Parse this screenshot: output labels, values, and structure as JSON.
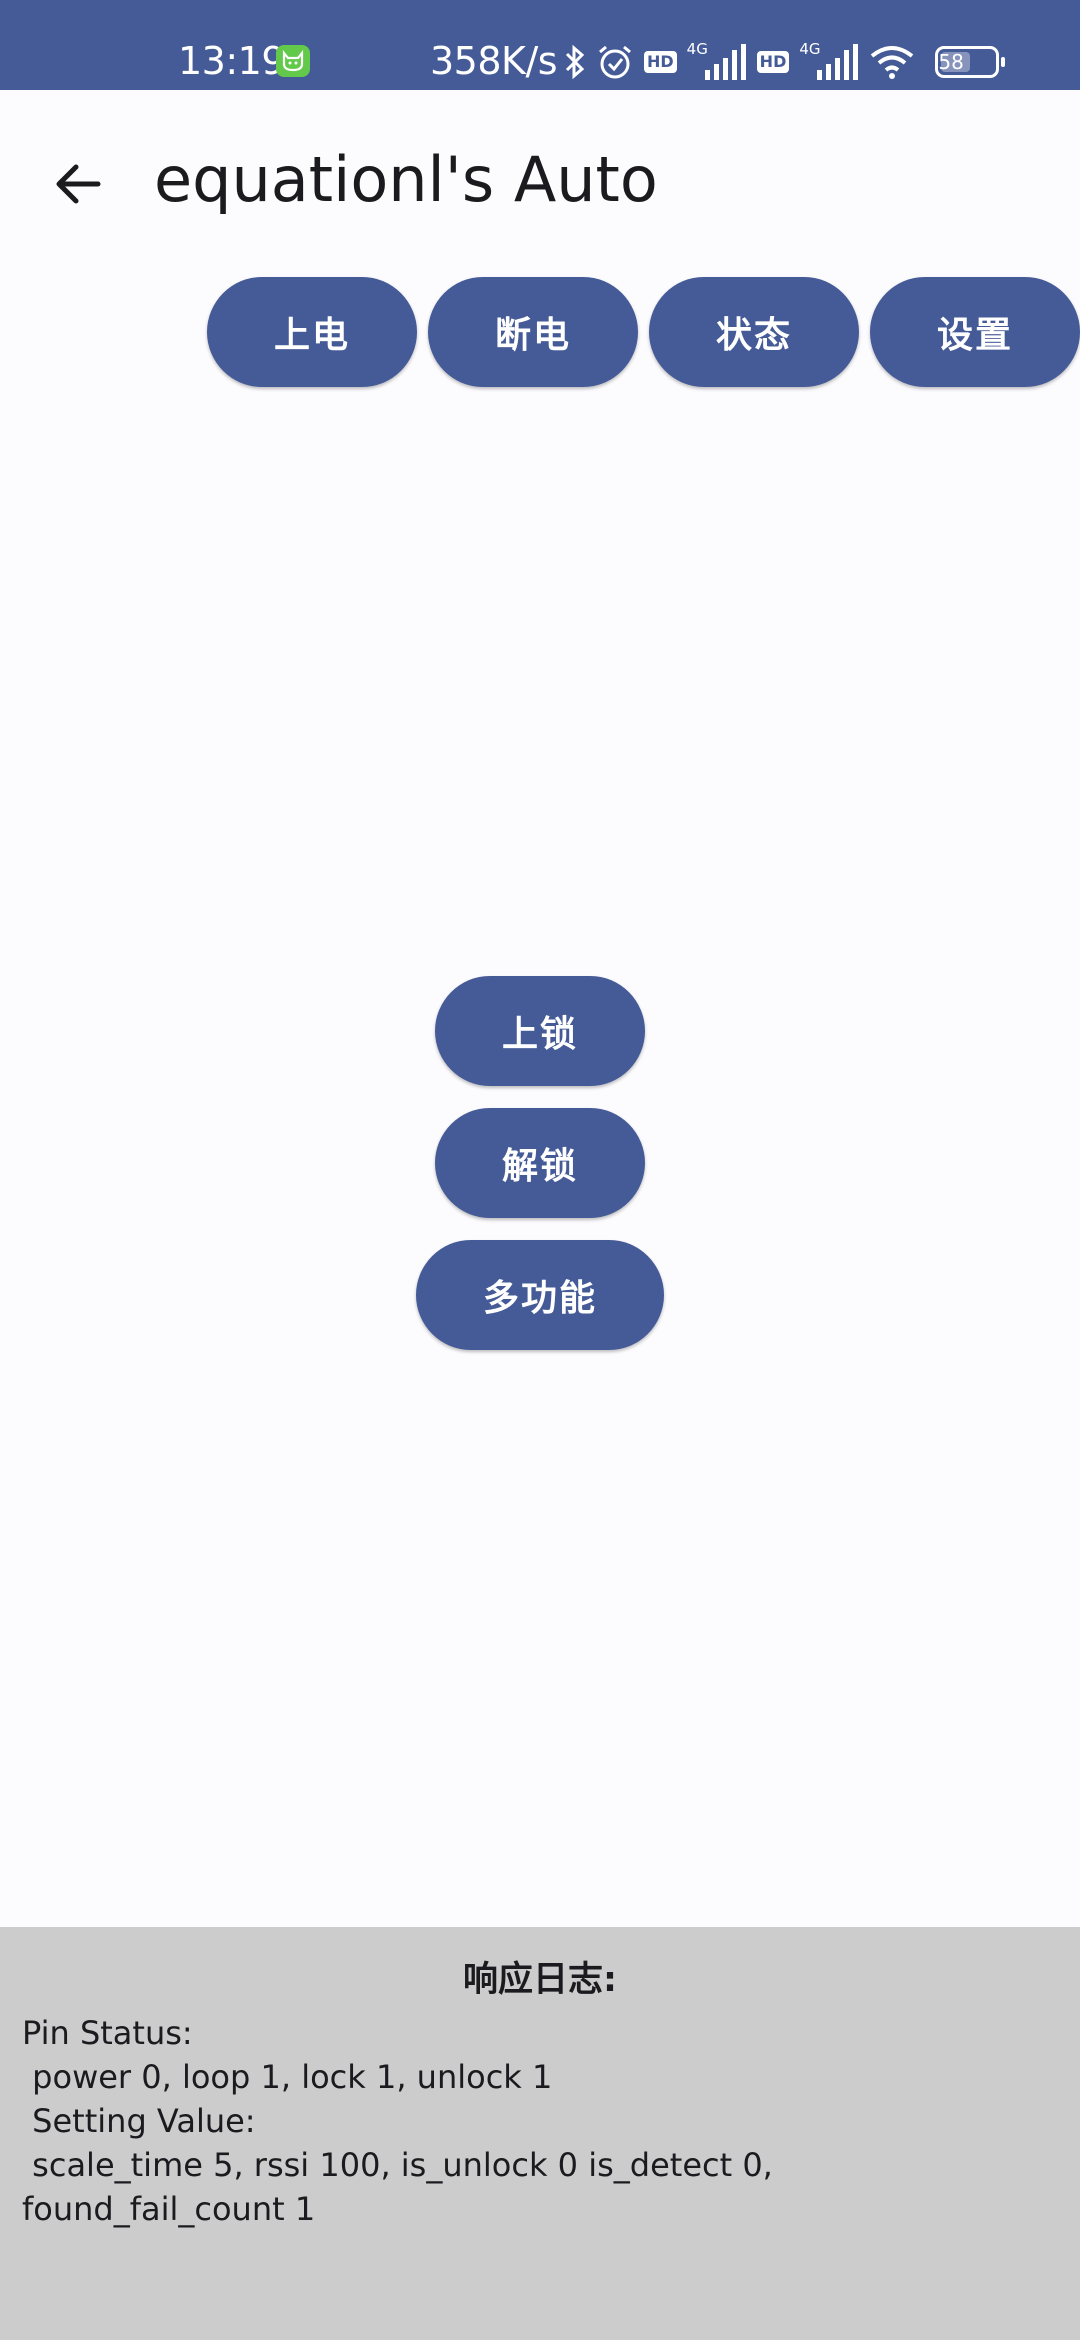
{
  "status_bar": {
    "time": "13:19",
    "app_icon": "cat-icon",
    "net_speed": "358K/s",
    "icons": [
      "bluetooth-icon",
      "alarm-icon",
      "hd-icon",
      "signal-4g-icon",
      "hd-icon",
      "signal-4g-icon",
      "wifi-icon",
      "battery-icon"
    ],
    "hd_label": "HD",
    "sig_label": "4G",
    "battery_level": "58",
    "bg_color": "#455b97"
  },
  "app_bar": {
    "back_icon": "arrow-left-icon",
    "title": "equationl's Auto"
  },
  "top_buttons": {
    "power_on": "上电",
    "power_off": "断电",
    "status": "状态",
    "settings": "设置"
  },
  "center_buttons": {
    "lock": "上锁",
    "unlock": "解锁",
    "multi_function": "多功能"
  },
  "log": {
    "title": "响应日志:",
    "lines": [
      "Pin Status:",
      " power 0, loop 1, lock 1, unlock 1",
      " Setting Value:",
      " scale_time 5, rssi 100, is_unlock 0 is_detect 0,",
      "found_fail_count 1"
    ]
  },
  "colors": {
    "button": "#455b97",
    "background": "#fcfbfe",
    "log_background": "#cccccc"
  }
}
